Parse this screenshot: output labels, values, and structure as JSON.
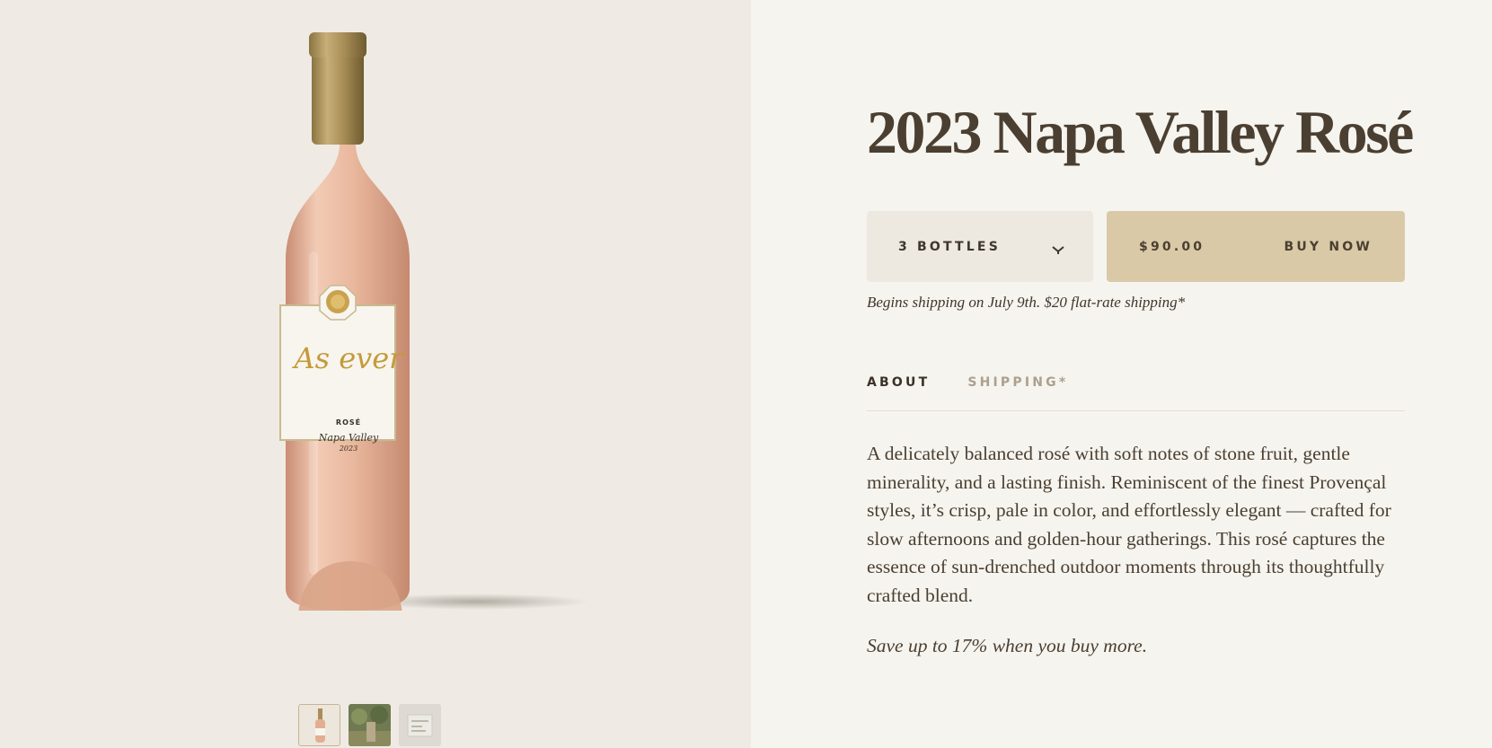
{
  "gallery": {
    "bottle_label": {
      "script": "As ever",
      "wine": "ROSÉ",
      "region": "Napa Valley",
      "vintage": "2023"
    },
    "thumbnails": [
      {
        "name": "bottle",
        "active": true
      },
      {
        "name": "vineyard",
        "active": false
      },
      {
        "name": "label-detail",
        "active": false
      }
    ]
  },
  "product": {
    "title": "2023 Napa Valley Rosé",
    "quantity_selected": "3 BOTTLES",
    "price": "$90.00",
    "buy_label": "BUY NOW",
    "shipping_note": "Begins shipping on July 9th. $20 flat-rate shipping*"
  },
  "tabs": [
    {
      "label": "ABOUT",
      "active": true
    },
    {
      "label": "SHIPPING*",
      "active": false
    }
  ],
  "about": {
    "description": "A delicately balanced rosé with soft notes of stone fruit, gentle minerality, and a lasting finish. Reminiscent of the finest Provençal styles, it’s crisp, pale in color, and effortlessly elegant — crafted for slow afternoons and golden-hour gatherings. This rosé captures the essence of sun-drenched outdoor moments through its thoughtfully crafted blend.",
    "save_note": "Save up to 17% when you buy more."
  },
  "colors": {
    "accent": "#d9c9a7",
    "text": "#4a3f31",
    "panel_bg": "#f6f4ef",
    "gallery_bg": "#efebe4",
    "select_bg": "#ede8e0"
  },
  "icons": {
    "dropdown": "chevron-down-icon"
  }
}
